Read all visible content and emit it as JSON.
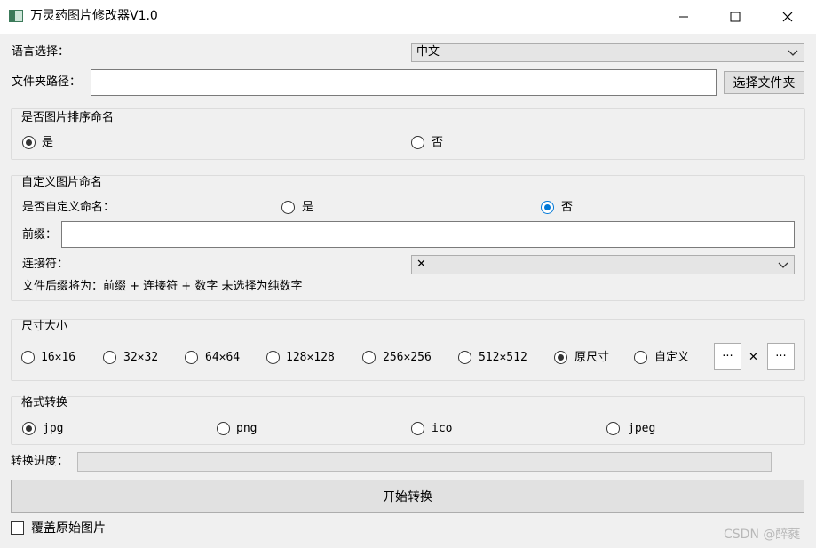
{
  "window": {
    "title": "万灵药图片修改器V1.0"
  },
  "language": {
    "label": "语言选择：",
    "value": "中文"
  },
  "folder": {
    "label": "文件夹路径：",
    "value": "",
    "browse_label": "选择文件夹"
  },
  "sort_group": {
    "title": "是否图片排序命名",
    "options": [
      {
        "label": "是",
        "selected": true
      },
      {
        "label": "否",
        "selected": false
      }
    ]
  },
  "custom_group": {
    "title": "自定义图片命名",
    "question": "是否自定义命名：",
    "options": [
      {
        "label": "是",
        "selected": false
      },
      {
        "label": "否",
        "selected": true
      }
    ],
    "prefix_label": "前缀：",
    "prefix_value": "",
    "connector_label": "连接符：",
    "connector_value": "✕",
    "hint": "文件后缀将为：前缀 + 连接符 + 数字 未选择为纯数字"
  },
  "size_group": {
    "title": "尺寸大小",
    "options": [
      {
        "label": "16✕16",
        "selected": false
      },
      {
        "label": "32✕32",
        "selected": false
      },
      {
        "label": "64✕64",
        "selected": false
      },
      {
        "label": "128✕128",
        "selected": false
      },
      {
        "label": "256✕256",
        "selected": false
      },
      {
        "label": "512✕512",
        "selected": false
      },
      {
        "label": "原尺寸",
        "selected": true
      },
      {
        "label": "自定义",
        "selected": false
      }
    ],
    "custom_width_label": "···",
    "times": "✕",
    "custom_height_label": "···"
  },
  "format_group": {
    "title": "格式转换",
    "options": [
      {
        "label": "jpg",
        "selected": true
      },
      {
        "label": "png",
        "selected": false
      },
      {
        "label": "ico",
        "selected": false
      },
      {
        "label": "jpeg",
        "selected": false
      }
    ]
  },
  "progress": {
    "label": "转换进度：",
    "value": 0
  },
  "start_button": {
    "label": "开始转换"
  },
  "overwrite": {
    "label": "覆盖原始图片",
    "checked": false
  },
  "watermark": "CSDN @醉蕤",
  "colors": {
    "accent": "#0078d7",
    "window_bg": "#f0f0f0",
    "button_bg": "#e1e1e1"
  }
}
